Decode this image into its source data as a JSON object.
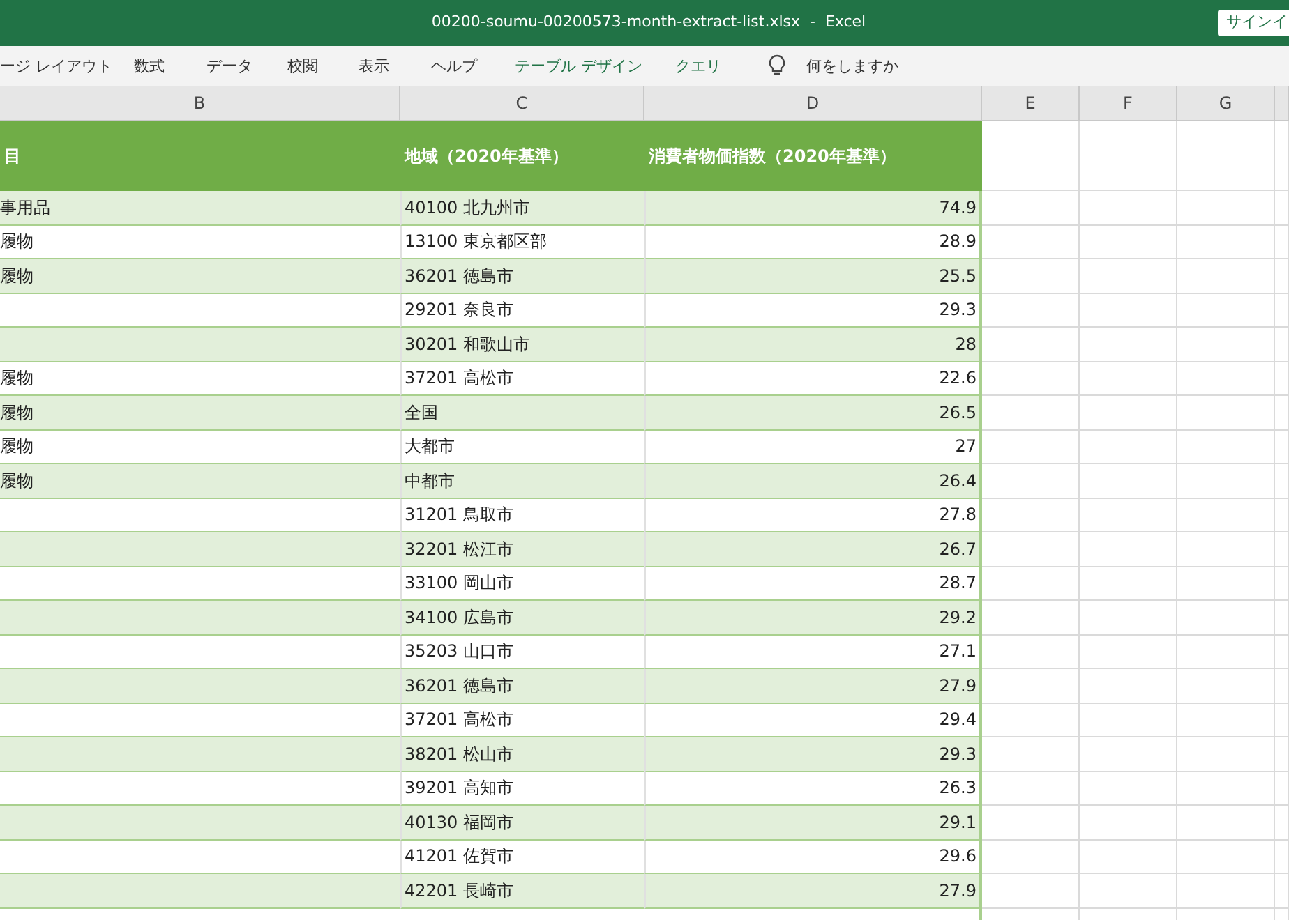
{
  "window": {
    "title": "00200-soumu-00200573-month-extract-list.xlsx  -  Excel",
    "sign_in_button": "サインイ"
  },
  "ribbon_tabs": [
    {
      "label": "ージ レイアウト",
      "contextual": false
    },
    {
      "label": "数式",
      "contextual": false
    },
    {
      "label": "データ",
      "contextual": false
    },
    {
      "label": "校閲",
      "contextual": false
    },
    {
      "label": "表示",
      "contextual": false
    },
    {
      "label": "ヘルプ",
      "contextual": false
    },
    {
      "label": "テーブル デザイン",
      "contextual": true
    },
    {
      "label": "クエリ",
      "contextual": true
    }
  ],
  "tell_me": {
    "placeholder": "何をしますか"
  },
  "column_headers": [
    "B",
    "C",
    "D",
    "E",
    "F",
    "G"
  ],
  "table": {
    "columns": [
      "目",
      "地域（2020年基準）",
      "消費者物価指数（2020年基準）"
    ],
    "rows": [
      {
        "item": "事用品",
        "region": "40100 北九州市",
        "value": "74.9"
      },
      {
        "item": "履物",
        "region": "13100 東京都区部",
        "value": "28.9"
      },
      {
        "item": "履物",
        "region": "36201 徳島市",
        "value": "25.5"
      },
      {
        "item": "",
        "region": "29201 奈良市",
        "value": "29.3"
      },
      {
        "item": "",
        "region": "30201 和歌山市",
        "value": "28"
      },
      {
        "item": "履物",
        "region": "37201 高松市",
        "value": "22.6"
      },
      {
        "item": "履物",
        "region": "全国",
        "value": "26.5"
      },
      {
        "item": "履物",
        "region": "大都市",
        "value": "27"
      },
      {
        "item": "履物",
        "region": "中都市",
        "value": "26.4"
      },
      {
        "item": "",
        "region": "31201 鳥取市",
        "value": "27.8"
      },
      {
        "item": "",
        "region": "32201 松江市",
        "value": "26.7"
      },
      {
        "item": "",
        "region": "33100 岡山市",
        "value": "28.7"
      },
      {
        "item": "",
        "region": "34100 広島市",
        "value": "29.2"
      },
      {
        "item": "",
        "region": "35203 山口市",
        "value": "27.1"
      },
      {
        "item": "",
        "region": "36201 徳島市",
        "value": "27.9"
      },
      {
        "item": "",
        "region": "37201 高松市",
        "value": "29.4"
      },
      {
        "item": "",
        "region": "38201 松山市",
        "value": "29.3"
      },
      {
        "item": "",
        "region": "39201 高知市",
        "value": "26.3"
      },
      {
        "item": "",
        "region": "40130 福岡市",
        "value": "29.1"
      },
      {
        "item": "",
        "region": "41201 佐賀市",
        "value": "29.6"
      },
      {
        "item": "",
        "region": "42201 長崎市",
        "value": "27.9"
      }
    ]
  }
}
